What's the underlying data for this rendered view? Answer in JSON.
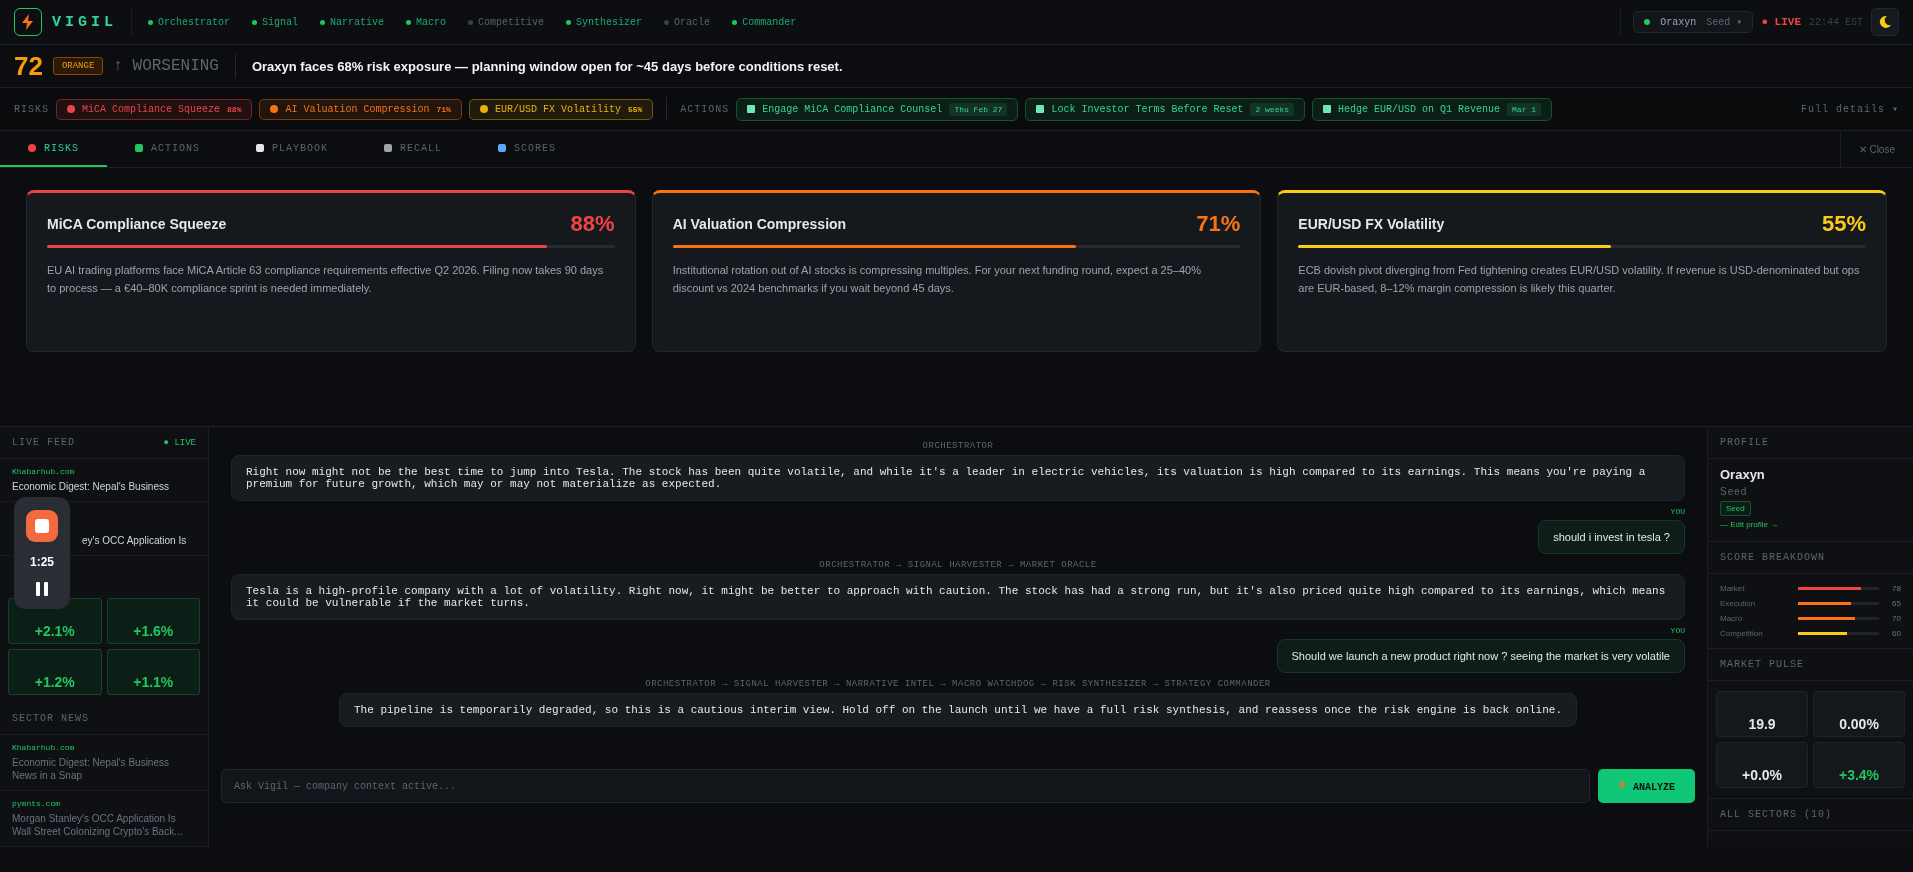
{
  "brand": {
    "name": "VIGIL"
  },
  "agents": [
    {
      "label": "Orchestrator",
      "active": true
    },
    {
      "label": "Signal",
      "active": true
    },
    {
      "label": "Narrative",
      "active": true
    },
    {
      "label": "Macro",
      "active": true
    },
    {
      "label": "Competitive",
      "active": false
    },
    {
      "label": "Synthesizer",
      "active": true
    },
    {
      "label": "Oracle",
      "active": false
    },
    {
      "label": "Commander",
      "active": true
    }
  ],
  "company_pill": {
    "name": "Oraxyn",
    "stage": "Seed ▾"
  },
  "live": {
    "label": "● LIVE",
    "time": "22:44 EST"
  },
  "alert": {
    "score": "72",
    "level": "ORANGE",
    "trend": "↑ WORSENING",
    "headline": "Oraxyn faces 68% risk exposure — planning window open for ~45 days before conditions reset."
  },
  "risk_label": "RISKS",
  "risk_chips": [
    {
      "label": "MiCA Compliance Squeeze",
      "pct": "88%",
      "color": "#ef4444"
    },
    {
      "label": "AI Valuation Compression",
      "pct": "71%",
      "color": "#f97316"
    },
    {
      "label": "EUR/USD FX Volatility",
      "pct": "55%",
      "color": "#eab308"
    }
  ],
  "action_label": "ACTIONS",
  "action_chips": [
    {
      "label": "Engage MiCA Compliance Counsel",
      "due": "Thu Feb 27"
    },
    {
      "label": "Lock Investor Terms Before Reset",
      "due": "2 weeks"
    },
    {
      "label": "Hedge EUR/USD on Q1 Revenue",
      "due": "Mar 1"
    }
  ],
  "full_details": "Full details ▾",
  "tabs": [
    {
      "label": "RISKS",
      "selected": true,
      "color": "#ef4444"
    },
    {
      "label": "ACTIONS",
      "selected": false,
      "color": "#22c55e"
    },
    {
      "label": "PLAYBOOK",
      "selected": false,
      "color": "#e5e7eb"
    },
    {
      "label": "RECALL",
      "selected": false,
      "color": "#9ca3af"
    },
    {
      "label": "SCORES",
      "selected": false,
      "color": "#60a5fa"
    }
  ],
  "close": "✕ Close",
  "cards": [
    {
      "title": "MiCA Compliance Squeeze",
      "pct": "88%",
      "level": 0.88,
      "color": "#ef4444",
      "text": "EU AI trading platforms face MiCA Article 63 compliance requirements effective Q2 2026. Filing now takes 90 days to process — a €40–80K compliance sprint is needed immediately."
    },
    {
      "title": "AI Valuation Compression",
      "pct": "71%",
      "level": 0.71,
      "color": "#f97316",
      "text": "Institutional rotation out of AI stocks is compressing multiples. For your next funding round, expect a 25–40% discount vs 2024 benchmarks if you wait beyond 45 days."
    },
    {
      "title": "EUR/USD FX Volatility",
      "pct": "55%",
      "level": 0.55,
      "color": "#facc15",
      "text": "ECB dovish pivot diverging from Fed tightening creates EUR/USD volatility. If revenue is USD-denominated but ops are EUR-based, 8–12% margin compression is likely this quarter."
    }
  ],
  "feed": {
    "title": "LIVE FEED",
    "live": "● LIVE",
    "items": [
      {
        "source": "Khabarhub.com",
        "title": "Economic Digest: Nepal's Business"
      },
      {
        "title": "ey's OCC Application Is"
      }
    ]
  },
  "pulse_tiles": [
    {
      "value": "+2.1%"
    },
    {
      "value": "+1.6%"
    },
    {
      "value": "+1.2%"
    },
    {
      "value": "+1.1%"
    }
  ],
  "sector_news": {
    "title": "SECTOR NEWS",
    "items": [
      {
        "source": "Khabarhub.com",
        "title": "Economic Digest: Nepal's Business News in a Snap"
      },
      {
        "source": "pymnts.com",
        "title": "Morgan Stanley's OCC Application Is Wall Street Colonizing Crypto's Back..."
      }
    ]
  },
  "recorder": {
    "time": "1:25"
  },
  "messages": [
    {
      "kind": "agent",
      "route": "ORCHESTRATOR",
      "text": "Right now might not be the best time to jump into Tesla. The stock has been quite volatile, and while it's a leader in electric vehicles, its valuation is high compared to its earnings. This means you're paying a premium for future growth, which may or may not materialize as expected."
    },
    {
      "kind": "user",
      "route": "YOU",
      "text": "should i invest in tesla ?"
    },
    {
      "kind": "agent",
      "route": "ORCHESTRATOR → SIGNAL HARVESTER → MARKET ORACLE",
      "text": "Tesla is a high-profile company with a lot of volatility. Right now, it might be better to approach with caution. The stock has had a strong run, but it's also priced quite high compared to its earnings, which means it could be vulnerable if the market turns."
    },
    {
      "kind": "user",
      "route": "YOU",
      "text": "Should we launch a new product right now ? seeing the market is very volatile"
    },
    {
      "kind": "agent",
      "route": "ORCHESTRATOR → SIGNAL HARVESTER → NARRATIVE INTEL → MACRO WATCHDOG → RISK SYNTHESIZER → STRATEGY COMMANDER",
      "text": "The pipeline is temporarily degraded, so this is a cautious interim view. Hold off on the launch until we have a full risk synthesis, and reassess once the risk engine is back online."
    }
  ],
  "input": {
    "placeholder": "Ask Vigil — company context active..."
  },
  "analyze": "ANALYZE",
  "profile": {
    "title": "PROFILE",
    "name": "Oraxyn",
    "stage": "Seed",
    "badge": "Seed",
    "edit": "— Edit profile →"
  },
  "breakdown": {
    "title": "SCORE BREAKDOWN",
    "rows": [
      {
        "label": "Market",
        "value": "78",
        "level": 0.78,
        "color": "#ef4444"
      },
      {
        "label": "Execution",
        "value": "65",
        "level": 0.65,
        "color": "#f97316"
      },
      {
        "label": "Macro",
        "value": "70",
        "level": 0.7,
        "color": "#f97316"
      },
      {
        "label": "Competition",
        "value": "60",
        "level": 0.6,
        "color": "#facc15"
      }
    ]
  },
  "market_pulse": {
    "title": "MARKET PULSE",
    "tiles": [
      {
        "value": "19.9",
        "color": "#e5e7eb"
      },
      {
        "value": "0.00%",
        "color": "#e5e7eb"
      },
      {
        "value": "+0.0%",
        "color": "#e5e7eb"
      },
      {
        "value": "+3.4%",
        "color": "#22c55e"
      }
    ]
  },
  "sectors_title": "ALL SECTORS (10)"
}
